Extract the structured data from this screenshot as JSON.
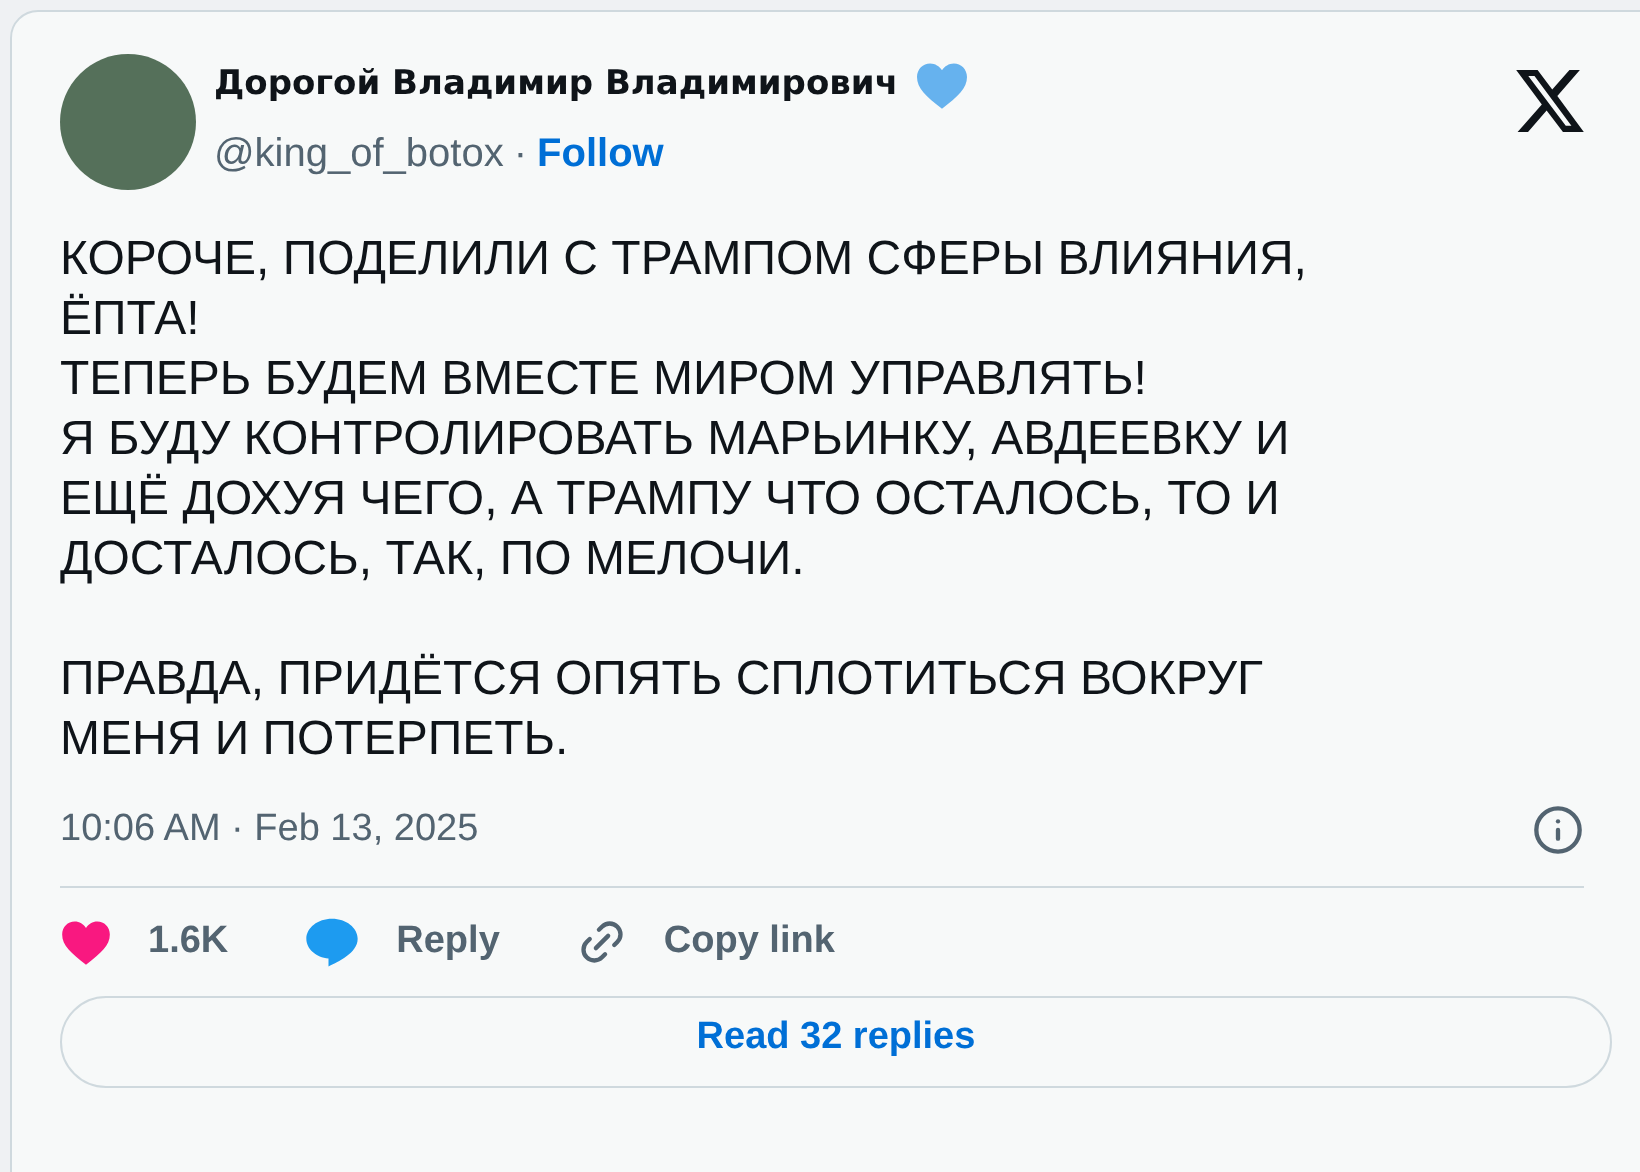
{
  "author": {
    "name": "Дорогой Владимир Владимирович",
    "verified": true,
    "handle": "@king_of_botox",
    "separator": "·",
    "follow": "Follow"
  },
  "body": [
    [
      "КОРОЧЕ, ПОДЕЛИЛИ С ТРАМПОМ СФЕРЫ ВЛИЯНИЯ,",
      "ЁПТА!",
      "ТЕПЕРЬ БУДЕМ ВМЕСТЕ МИРОМ УПРАВЛЯТЬ!",
      "Я БУДУ КОНТРОЛИРОВАТЬ МАРЬИНКУ, АВДЕЕВКУ И",
      "ЕЩЁ ДОХУЯ ЧЕГО, А ТРАМПУ ЧТО ОСТАЛОСЬ, ТО И",
      "ДОСТАЛОСЬ, ТАК, ПО МЕЛОЧИ."
    ],
    [
      "ПРАВДА, ПРИДЁТСЯ ОПЯТЬ СПЛОТИТЬСЯ ВОКРУГ",
      "МЕНЯ И ПОТЕРПЕТЬ."
    ]
  ],
  "timestamp": "10:06 AM · Feb 13, 2025",
  "actions": [
    {
      "kind": "like",
      "label": "1.6K"
    },
    {
      "kind": "reply",
      "label": "Reply"
    },
    {
      "kind": "copy",
      "label": "Copy link"
    }
  ],
  "read_replies": "Read 32 replies"
}
